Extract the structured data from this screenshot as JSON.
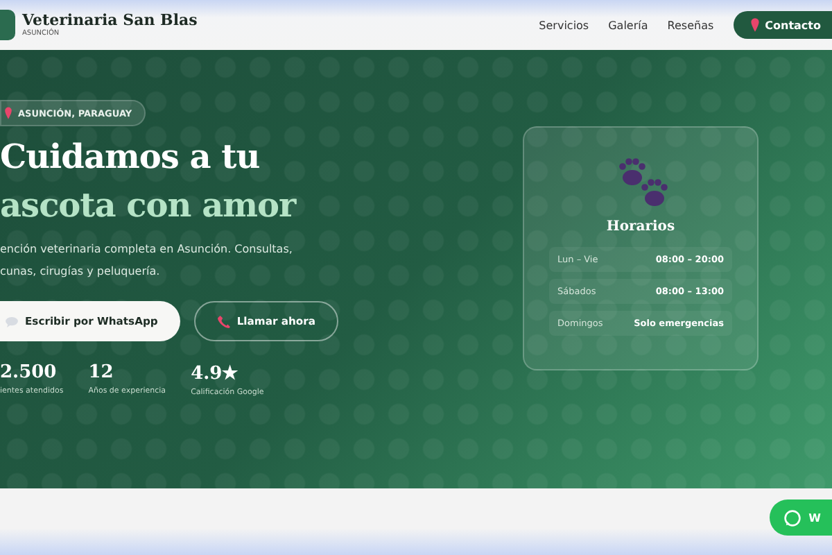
{
  "header": {
    "brand": "Veterinaria San Blas",
    "subtitle": "ASUNCIÓN",
    "nav": [
      {
        "label": "Servicios"
      },
      {
        "label": "Galería"
      },
      {
        "label": "Reseñas"
      }
    ],
    "contact_button": "Contacto"
  },
  "hero": {
    "badge": "ASUNCIÓN, PARAGUAY",
    "title_line_1": "Cuidamos a tu",
    "title_line_2": "ascota con amor",
    "description_lines": [
      "ención veterinaria completa en Asunción. Consultas,",
      "cunas, cirugías y peluquería."
    ],
    "buttons": [
      {
        "kind": "whatsapp",
        "label": "Escribir por WhatsApp"
      },
      {
        "kind": "call",
        "label": "Llamar ahora"
      }
    ],
    "stats": [
      {
        "value": "2.500",
        "label": "ientes atendidos"
      },
      {
        "value": "12",
        "label": "Años de experiencia"
      },
      {
        "value": "4.9★",
        "label": "Calificación Google"
      }
    ]
  },
  "hours_card": {
    "title": "Horarios",
    "rows": [
      {
        "day": "Lun – Vie",
        "hours": "08:00 – 20:00"
      },
      {
        "day": "Sábados",
        "hours": "08:00 – 13:00"
      },
      {
        "day": "Domingos",
        "hours": "Solo emergencias"
      }
    ]
  },
  "floating_button": {
    "label": "W"
  }
}
